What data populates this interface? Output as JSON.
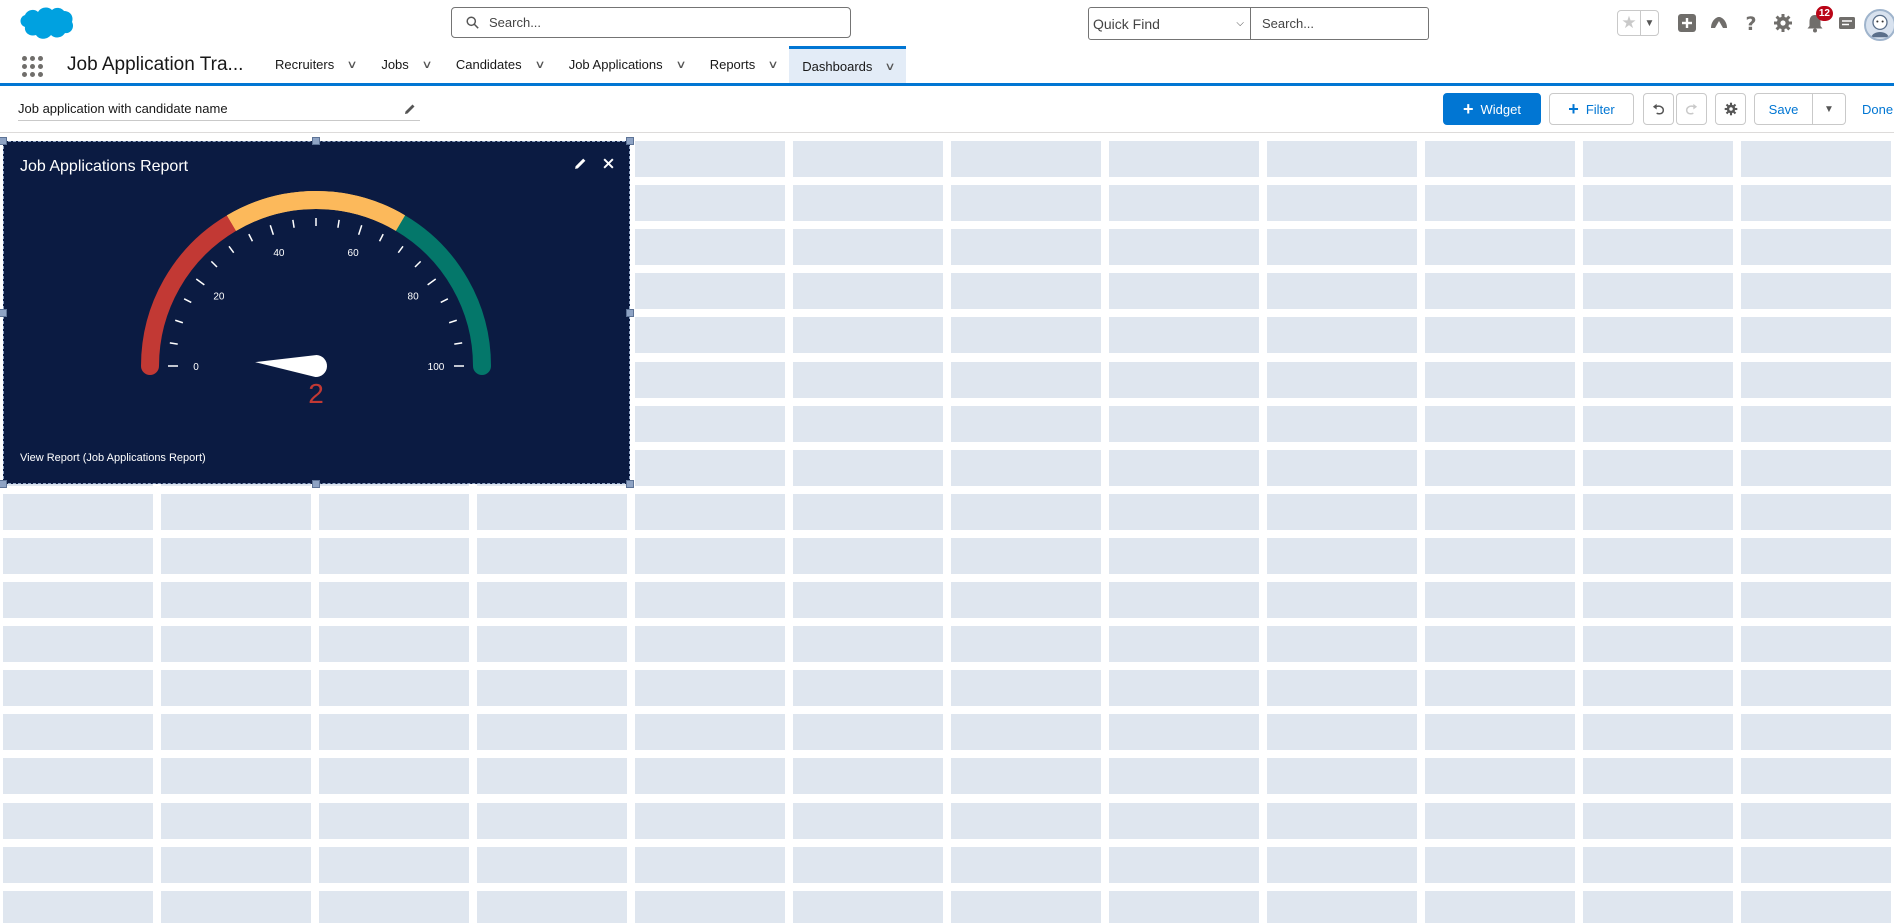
{
  "header": {
    "search_placeholder": "Search...",
    "quickfind_placeholder": "Quick Find",
    "setup_search_placeholder": "Search...",
    "notifications_count": "12"
  },
  "nav": {
    "app_name": "Job Application Tra...",
    "items": [
      {
        "label": "Recruiters"
      },
      {
        "label": "Jobs"
      },
      {
        "label": "Candidates"
      },
      {
        "label": "Job Applications"
      },
      {
        "label": "Reports"
      },
      {
        "label": "Dashboards"
      }
    ],
    "active": "Dashboards"
  },
  "toolbar": {
    "dashboard_title": "Job application with candidate name",
    "widget_label": "Widget",
    "filter_label": "Filter",
    "save_label": "Save",
    "done_label": "Done"
  },
  "widget": {
    "title": "Job Applications Report",
    "footer_link": "View Report (Job Applications Report)"
  },
  "chart_data": {
    "type": "gauge",
    "min": 0,
    "max": 100,
    "value": 2,
    "value_label": "2",
    "tick_labels": [
      "0",
      "20",
      "40",
      "60",
      "80",
      "100"
    ],
    "bands": [
      {
        "from": 0,
        "to": 33,
        "color": "#c23934"
      },
      {
        "from": 33,
        "to": 67,
        "color": "#fcb95b"
      },
      {
        "from": 67,
        "to": 100,
        "color": "#04776a"
      }
    ],
    "value_color": "#c23934"
  },
  "colors": {
    "brand": "#0176d3",
    "widget_bg": "#0b1b42",
    "grid_cell": "#dfe6ef"
  }
}
